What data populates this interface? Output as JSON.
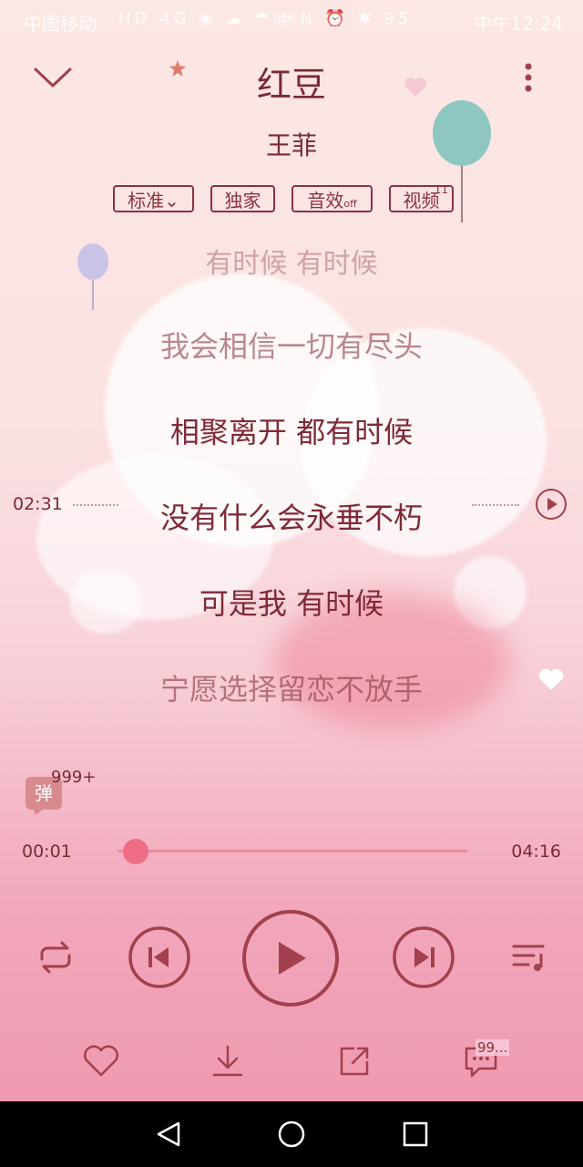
{
  "status_bar": {
    "carrier": "中国移动",
    "indicators": "HD 4G ◉ ☁ ☂ ✉",
    "right_indicators": "◎ N ⏰ ✱ 95",
    "time": "中午12:24"
  },
  "header": {
    "song_title": "红豆",
    "artist": "王菲"
  },
  "quality_pills": [
    {
      "label": "标准",
      "suffix": "⌄"
    },
    {
      "label": "独家",
      "suffix": ""
    },
    {
      "label": "音效",
      "suffix": "off"
    },
    {
      "label": "视频",
      "suffix": "",
      "badge": "11"
    }
  ],
  "lyrics": {
    "previous_partial": "有时候 有时候",
    "lines": [
      "我会相信一切有尽头",
      "相聚离开 都有时候",
      "没有什么会永垂不朽",
      "可是我 有时候",
      "宁愿选择留恋不放手"
    ],
    "seek_time": "02:31"
  },
  "barrage": {
    "label": "弹",
    "count": "999+"
  },
  "progress": {
    "elapsed": "00:01",
    "total": "04:16",
    "fraction": 0.004
  },
  "comment_badge": "99..."
}
